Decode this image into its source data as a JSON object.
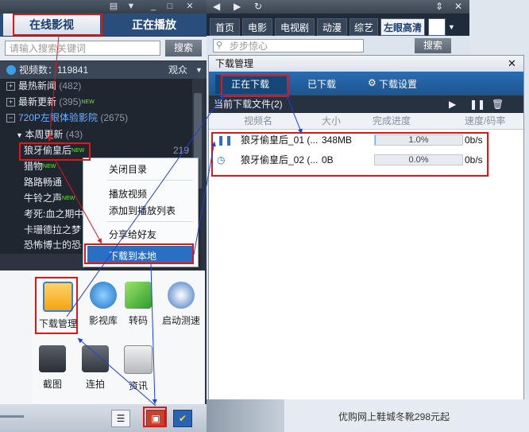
{
  "left": {
    "tabs": {
      "online": "在线影视",
      "playing": "正在播放"
    },
    "search": {
      "placeholder": "请输入搜索关键词",
      "button": "搜索"
    },
    "stats": {
      "count_label": "视频数：119841",
      "view": "观众"
    },
    "list": [
      {
        "label": "最热新闻",
        "count": "(482)"
      },
      {
        "label": "最新更新",
        "count": "(395)",
        "new": "NEW"
      },
      {
        "label": "720P左眼体验影院",
        "count": "(2675)"
      },
      {
        "label": "本周更新",
        "count": "(43)"
      },
      {
        "label": "狼牙偷皇后",
        "count": "219",
        "new": "NEW"
      },
      {
        "label": "猎物",
        "new": "NEW"
      },
      {
        "label": "路路畅通"
      },
      {
        "label": "牛铃之声",
        "new": "NEW"
      },
      {
        "label": "考死:血之期中"
      },
      {
        "label": "卡珊德拉之梦"
      },
      {
        "label": "恐怖博士的恐"
      }
    ],
    "context_menu": [
      "关闭目录",
      "播放视频",
      "添加到播放列表",
      "分享给好友",
      "下载到本地"
    ],
    "tools": [
      "下载管理",
      "影视库",
      "转码",
      "启动测速",
      "截图",
      "连拍",
      "资讯"
    ]
  },
  "right": {
    "nav_tabs": [
      "首页",
      "电影",
      "电视剧",
      "动漫",
      "综艺",
      "左眼高清"
    ],
    "search": {
      "placeholder": "步步惊心",
      "button": "搜索"
    },
    "download": {
      "title": "下载管理",
      "tabs": {
        "downloading": "正在下载",
        "downloaded": "已下载",
        "settings": "下载设置"
      },
      "subheader": "当前下载文件(2)",
      "columns": [
        "视频名",
        "大小",
        "完成进度",
        "速度/码率"
      ],
      "rows": [
        {
          "name": "狼牙偷皇后_01 (...",
          "size": "348MB",
          "progress": "1.0%",
          "progress_value": 0.01,
          "speed": "0b/s",
          "status": "paused"
        },
        {
          "name": "狼牙偷皇后_02 (...",
          "size": "0B",
          "progress": "0.0%",
          "progress_value": 0.0,
          "speed": "0b/s",
          "status": "waiting"
        }
      ]
    },
    "ad": "优购网上鞋城冬靴298元起"
  },
  "colors": {
    "highlight_red": "#e01717",
    "accent_blue": "#2b6fc5",
    "arrow_blue": "#1f3fd8"
  }
}
